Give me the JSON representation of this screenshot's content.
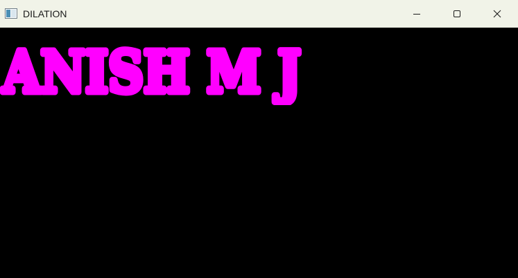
{
  "window": {
    "title": "DILATION",
    "app_icon": "window-app-icon",
    "controls": {
      "minimize": "minimize-icon",
      "maximize": "maximize-icon",
      "close": "close-icon"
    }
  },
  "canvas": {
    "text": "ANISH M J",
    "text_color": "#ff00ff",
    "background_color": "#000000"
  }
}
